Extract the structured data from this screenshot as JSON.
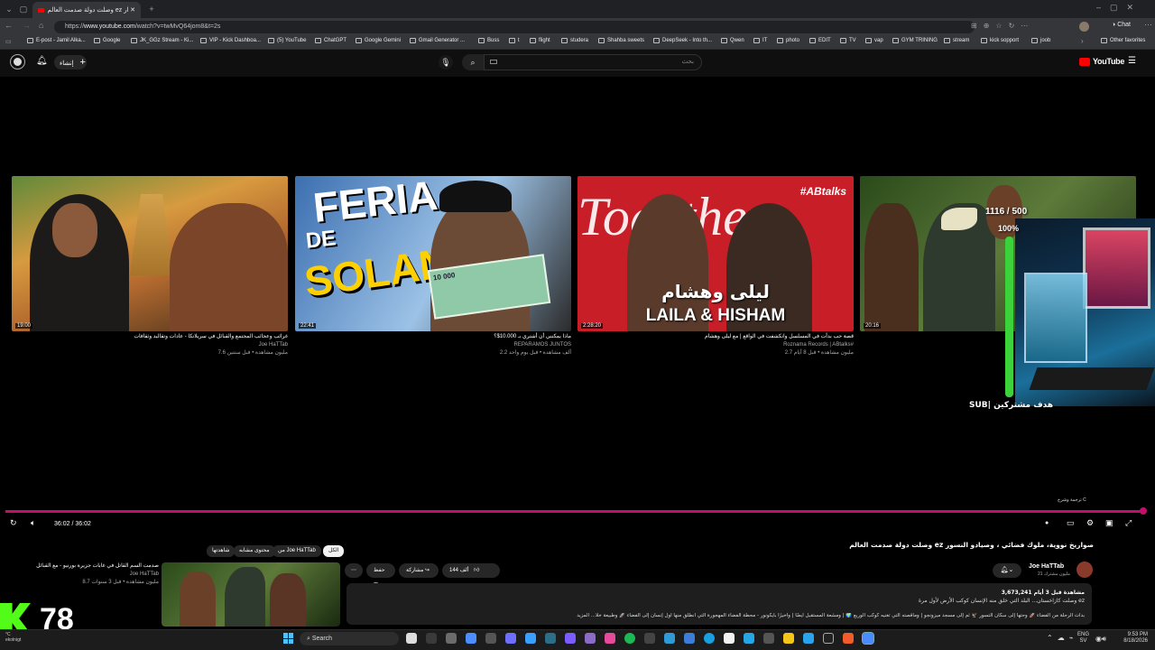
{
  "browser": {
    "tab_title": "وصلت دولة صدمت العالم ez صوار...",
    "url_prefix": "https://",
    "url_domain": "www.youtube.com",
    "url_path": "/watch?v=twMvQ64jom8&t=2s",
    "chat_label": "Chat",
    "bookmarks": [
      "E-post - Jamil Alka...",
      "Google",
      "JK_GGz Stream - Ki...",
      "VIP - Kick Dashboa...",
      "(5) YouTube",
      "ChatGPT",
      "Google Gemini",
      "Gmail Generator ...",
      "Buss",
      "t",
      "flight",
      "studera",
      "Shahba sweets",
      "DeepSeek - Into th...",
      "Qwen",
      "IT",
      "photo",
      "EDIT",
      "TV",
      "vap",
      "GYM TRINING",
      "stream",
      "kick sopport",
      "joob"
    ],
    "other_favorites": "Other favorites"
  },
  "youtube": {
    "create_label": "إنشاء",
    "search_placeholder": "بحث",
    "logo_text": "YouTube",
    "end_screen": [
      {
        "title": "غرائب وعجائب المجتمع والقبائل في سريلانكا - عادات وتقاليد وثقافات",
        "channel": "Joe HaTTab",
        "stats": "7.6 مليون مشاهدة • قبل سنتين",
        "duration": "19:00"
      },
      {
        "title": "ماذا يمكنني أن أشتري بـ 10.000$؟",
        "channel": "REPARAMOS JUNTOS",
        "stats": "2.2 ألف مشاهدة • قبل يوم واحد",
        "duration": "22:41"
      },
      {
        "title": "قصة حب بدأت في المسلسل وانكشفت في الواقع | مع ليلى وهشام",
        "channel": "Roznama Records | ABtalks#",
        "stats": "2.7 مليون مشاهدة • قبل 8 أيام",
        "duration": "2:28:20"
      },
      {
        "title": "",
        "channel": "",
        "stats": "",
        "duration": "20:16"
      }
    ],
    "thumb_texts": {
      "feria": "FERIA",
      "de": "DE",
      "solano": "SOLANO",
      "abtalks": "#ABtalks",
      "together": "Together",
      "laila_ar": "ليلى وهشام",
      "laila_en": "LAILA & HISHAM",
      "banknote": "10 000"
    },
    "overlay": {
      "sub_goal": "1116 / 500",
      "percent": "100%",
      "sub_label": "SUB| هدف مشتركين"
    },
    "captions_hint": "ترجمة وشرح C",
    "player": {
      "time": "36:02 / 36:02"
    },
    "video": {
      "title": "وصلت دولة صدمت العالم ez صواريخ نووية، ملوك فضائي ، وصيادو النسور",
      "channel": "Joe HaTTab",
      "subscribers": "21 مليون مشترك",
      "likes": "144 ألف",
      "share": "مشاركة",
      "save": "حفظ",
      "views_line": "3,673,241 مشاهدة قبل 3 أيام",
      "desc1": "وصلت كازاخستان... البلد التي خلق منه الإنسان كوكب الأرض لأول مرة ez",
      "desc2": "بدأت الرحلة من الفضاء 🚀 وحتها إلى سكان التسور 🦅 ثم إلى مسجد ميزونجو | وماقصته التي تغنيه كوكب الوريع 🌍 | ومشعة المستقبل أيضًا | وأخيرًا بايكونور - محطة الفضاء المهجورة التي انطلق منها أول إنسان إلى الفضاء 🚀 وطبيعة خلا... المزيد"
    },
    "chips": [
      "الكل",
      "من Joe HaTTab",
      "محتوى مشابه",
      "شاهدتها"
    ],
    "sidebar_video": {
      "title": "صدمت السم القاتل في غابات جزيرة بورنيو - مع القبائل",
      "channel": "Joe HaTTab",
      "stats": "8.7 مليون مشاهدة • قبل 3 سنوات"
    },
    "counter": "78"
  },
  "taskbar": {
    "search": "Search",
    "lang": "ENG",
    "lang2": "SV",
    "time": "9:53 PM",
    "date": "8/18/2026",
    "weather_line1": "°C",
    "weather_line2": "ekolnigt"
  },
  "colors": {
    "accent": "#c0106a",
    "youtube_red": "#ff0000",
    "kick_green": "#53fc18",
    "progress": "#c0106a"
  }
}
